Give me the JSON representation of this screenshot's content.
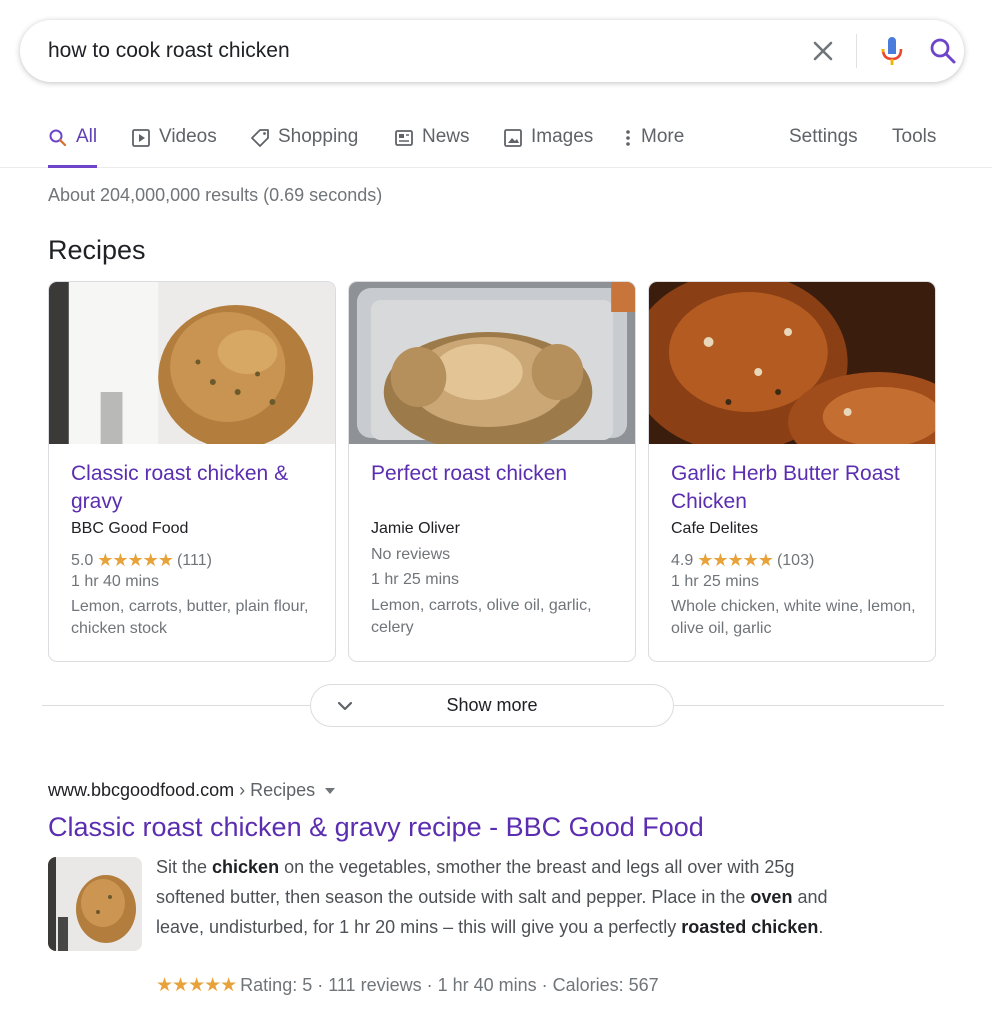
{
  "search": {
    "query": "how to cook roast chicken",
    "clear_icon": "close-icon",
    "mic_icon": "microphone-icon",
    "search_icon": "search-icon"
  },
  "tabs": [
    {
      "label": "All",
      "icon": "search-icon",
      "active": true
    },
    {
      "label": "Videos",
      "icon": "play-icon"
    },
    {
      "label": "Shopping",
      "icon": "tag-icon"
    },
    {
      "label": "News",
      "icon": "newspaper-icon"
    },
    {
      "label": "Images",
      "icon": "image-icon"
    },
    {
      "label": "More",
      "icon": "more-vertical-icon"
    },
    {
      "label": "Settings"
    },
    {
      "label": "Tools"
    }
  ],
  "result_stats": "About 204,000,000 results (0.69 seconds)",
  "recipes": {
    "heading": "Recipes",
    "cards": [
      {
        "title": "Classic roast chicken & gravy",
        "source": "BBC Good Food",
        "rating": "5.0",
        "stars": "★★★★★",
        "reviews": "(111)",
        "time": "1 hr 40 mins",
        "ingredients": "Lemon, carrots, butter, plain flour, chicken stock"
      },
      {
        "title": "Perfect roast chicken",
        "source": "Jamie Oliver",
        "no_reviews": "No reviews",
        "time": "1 hr 25 mins",
        "ingredients": "Lemon, carrots, olive oil, garlic, celery"
      },
      {
        "title": "Garlic Herb Butter Roast Chicken",
        "source": "Cafe Delites",
        "rating": "4.9",
        "stars": "★★★★★",
        "reviews": "(103)",
        "time": "1 hr 25 mins",
        "ingredients": "Whole chicken, white wine, lemon, olive oil, garlic"
      }
    ],
    "show_more": "Show more"
  },
  "result": {
    "domain": "www.bbcgoodfood.com",
    "breadcrumb": " › Recipes",
    "title": "Classic roast chicken & gravy recipe - BBC Good Food",
    "snippet": {
      "p1": "Sit the ",
      "b1": "chicken",
      "p2": " on the vegetables, smother the breast and legs all over with 25g softened butter, then season the outside with salt and pepper. Place in the ",
      "b2": "oven",
      "p3": " and leave, undisturbed, for 1 hr 20 mins – this will give you a perfectly ",
      "b3": "roasted chicken",
      "p4": "."
    },
    "stars": "★★★★★",
    "meta": "Rating: 5 · 111 reviews · 1 hr 40 mins · Calories: 567"
  },
  "colors": {
    "link_purple": "#5b2db0",
    "active_tab": "#6e45c9",
    "star": "#e7a23a"
  }
}
